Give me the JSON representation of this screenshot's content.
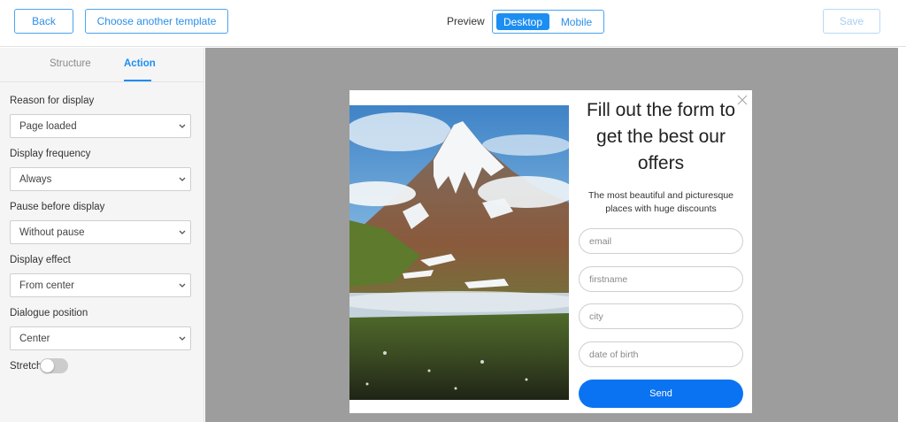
{
  "toolbar": {
    "back_label": "Back",
    "template_label": "Choose another template",
    "preview_label": "Preview",
    "desktop_label": "Desktop",
    "mobile_label": "Mobile",
    "save_label": "Save"
  },
  "sidebar": {
    "tabs": [
      {
        "label": "Structure",
        "active": false
      },
      {
        "label": "Action",
        "active": true
      }
    ],
    "fields": [
      {
        "label": "Reason for display",
        "value": "Page loaded"
      },
      {
        "label": "Display frequency",
        "value": "Always"
      },
      {
        "label": "Pause before display",
        "value": "Without pause"
      },
      {
        "label": "Display effect",
        "value": "From center"
      },
      {
        "label": "Dialogue position",
        "value": "Center"
      }
    ],
    "stretch_label": "Stretch",
    "stretch_on": false
  },
  "popup": {
    "title": "Fill out the form to get the best our offers",
    "subtitle": "The most beautiful and picturesque places with huge discounts",
    "inputs": [
      {
        "placeholder": "email"
      },
      {
        "placeholder": "firstname"
      },
      {
        "placeholder": "city"
      },
      {
        "placeholder": "date of birth"
      }
    ],
    "send_label": "Send",
    "image_subject": "mountain-landscape"
  },
  "colors": {
    "accent": "#1c8ef2",
    "send_button": "#0a73f2",
    "preview_background": "#9d9d9d"
  }
}
